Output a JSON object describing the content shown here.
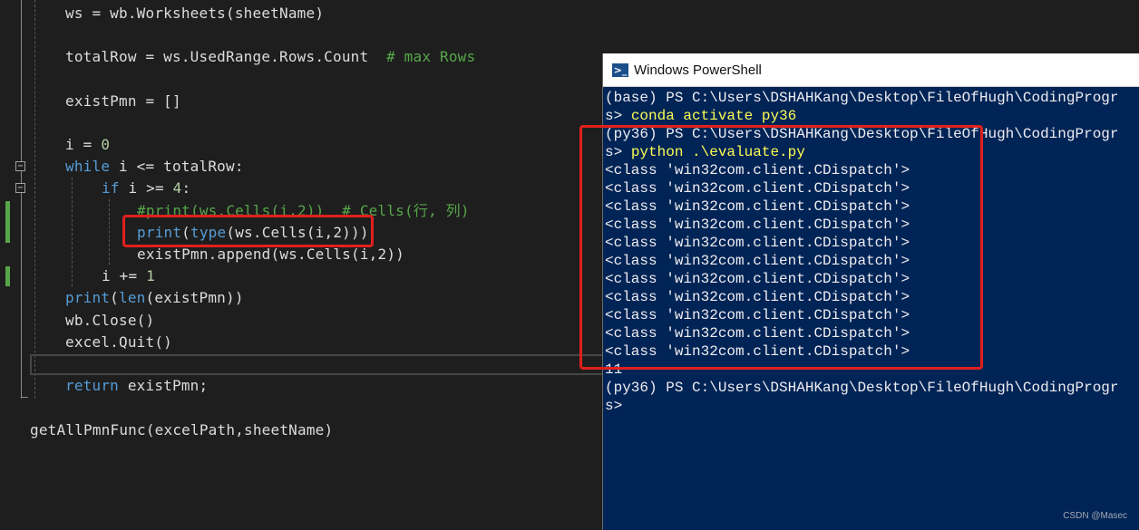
{
  "editor": {
    "line_ws": "ws = wb.Worksheets(sheetName)",
    "line_totalrow_code": "totalRow = ws.UsedRange.Rows.Count",
    "line_totalrow_comment": "# max Rows",
    "line_exist": "existPmn = []",
    "line_i0_a": "i = ",
    "line_i0_b": "0",
    "line_while_kw": "while",
    "line_while_rest": " i <= totalRow:",
    "line_if_kw": "if",
    "line_if_mid": " i >= ",
    "line_if_num": "4",
    "line_if_end": ":",
    "line_comment_print": "#print(ws.Cells(i,2))  # Cells(行, 列)",
    "line_print_fn": "print",
    "line_print_open": "(",
    "line_print_type": "type",
    "line_print_rest": "(ws.Cells(i,2)))",
    "line_append": "existPmn.append(ws.Cells(i,2))",
    "line_inc_a": "i += ",
    "line_inc_b": "1",
    "line_printlen_fn": "print",
    "line_printlen_open": "(",
    "line_printlen_len": "len",
    "line_printlen_rest": "(existPmn))",
    "line_close": "wb.Close()",
    "line_quit": "excel.Quit()",
    "line_return_kw": "return",
    "line_return_rest": " existPmn;",
    "line_call": "getAllPmnFunc(excelPath,sheetName)",
    "fold_symbol": "−"
  },
  "powershell": {
    "title": "Windows PowerShell",
    "icon": "powershell-icon",
    "icon_glyph": ">_",
    "prompt1": "(base) PS C:\\Users\\DSHAHKang\\Desktop\\FileOfHugh\\CodingProgr",
    "prompt1_cont": "s> ",
    "cmd1": "conda activate py36",
    "prompt2": "(py36) PS C:\\Users\\DSHAHKang\\Desktop\\FileOfHugh\\CodingProgr",
    "prompt2_cont": "s> ",
    "cmd2": "python .\\evaluate.py",
    "output_lines": [
      "<class 'win32com.client.CDispatch'>",
      "<class 'win32com.client.CDispatch'>",
      "<class 'win32com.client.CDispatch'>",
      "<class 'win32com.client.CDispatch'>",
      "<class 'win32com.client.CDispatch'>",
      "<class 'win32com.client.CDispatch'>",
      "<class 'win32com.client.CDispatch'>",
      "<class 'win32com.client.CDispatch'>",
      "<class 'win32com.client.CDispatch'>",
      "<class 'win32com.client.CDispatch'>",
      "<class 'win32com.client.CDispatch'>"
    ],
    "count": "11",
    "prompt3": "(py36) PS C:\\Users\\DSHAHKang\\Desktop\\FileOfHugh\\CodingProgr",
    "prompt3_cont": "s>"
  },
  "watermark": "CSDN @Masec",
  "colors": {
    "editor_bg": "#1e1e1e",
    "powershell_bg": "#012456",
    "highlight_red": "#e0201c",
    "keyword_blue": "#569cd6",
    "comment_green": "#57a64a"
  }
}
